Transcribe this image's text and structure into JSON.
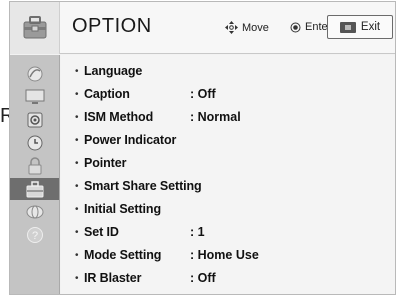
{
  "background_fragment": "R.",
  "header": {
    "title": "OPTION",
    "move_label": "Move",
    "enter_label": "Enter",
    "exit_label": "Exit"
  },
  "sidebar": {
    "items": [
      {
        "icon": "satellite-dish-icon",
        "selected": false
      },
      {
        "icon": "monitor-icon",
        "selected": false
      },
      {
        "icon": "speaker-icon",
        "selected": false
      },
      {
        "icon": "clock-icon",
        "selected": false
      },
      {
        "icon": "lock-icon",
        "selected": false
      },
      {
        "icon": "option-toolbox-icon",
        "selected": true
      },
      {
        "icon": "network-globe-icon",
        "selected": false
      },
      {
        "icon": "help-question-icon",
        "selected": false
      }
    ]
  },
  "menu": {
    "items": [
      {
        "label": "Language",
        "value": ""
      },
      {
        "label": "Caption",
        "value": ": Off"
      },
      {
        "label": "ISM Method",
        "value": ": Normal"
      },
      {
        "label": "Power Indicator",
        "value": ""
      },
      {
        "label": "Pointer",
        "value": ""
      },
      {
        "label": "Smart Share Setting",
        "value": ""
      },
      {
        "label": "Initial Setting",
        "value": ""
      },
      {
        "label": "Set ID",
        "value": ": 1"
      },
      {
        "label": "Mode Setting",
        "value": ": Home Use"
      },
      {
        "label": "IR Blaster",
        "value": ": Off"
      }
    ]
  },
  "bullet": "•",
  "colors": {
    "sidebar_bg": "#c4c4c4",
    "sidebar_selected": "#6e6e6e",
    "content_bg": "#f4f4f4"
  }
}
